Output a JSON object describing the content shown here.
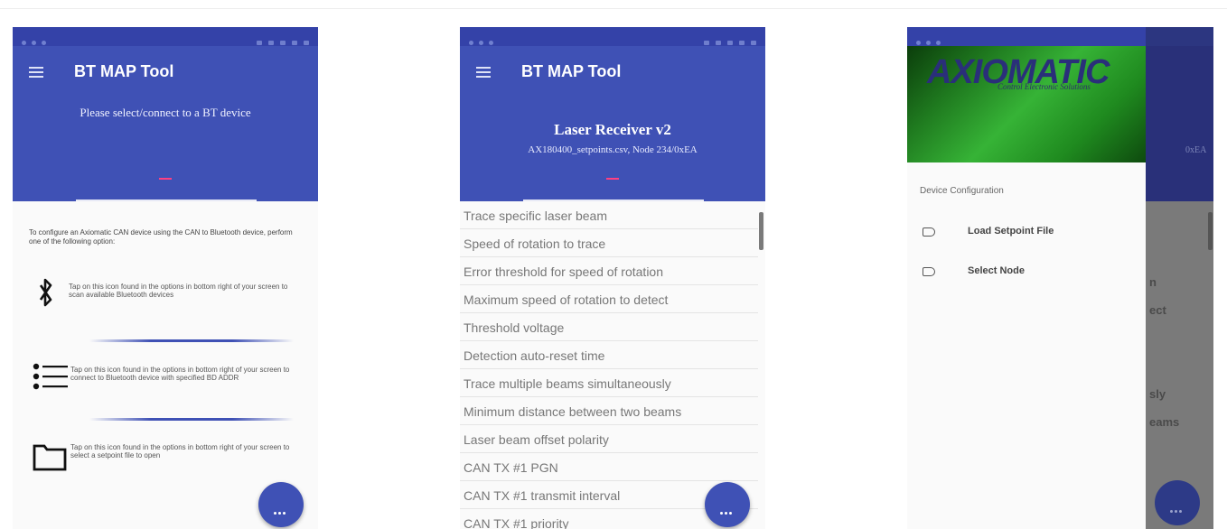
{
  "app": {
    "title": "BT MAP Tool"
  },
  "screen1": {
    "header_message": "Please select/connect to a BT device",
    "intro": "To configure an Axiomatic CAN device using the CAN to Bluetooth device, perform one of the following option:",
    "items": [
      {
        "icon": "bluetooth-icon",
        "text": "Tap on this icon found in the options in bottom right of your screen to scan available Bluetooth devices"
      },
      {
        "icon": "connect-list-icon",
        "text": "Tap on this icon found in the options in bottom right of your screen to connect to Bluetooth device with specified BD ADDR"
      },
      {
        "icon": "folder-icon",
        "text": "Tap on this icon found in the options in bottom right of your screen to select a setpoint file to open"
      }
    ],
    "fab_icon": "more-options-icon"
  },
  "screen2": {
    "device_name": "Laser Receiver v2",
    "device_file": "AX180400_setpoints.csv, Node 234/0xEA",
    "list": [
      "Trace specific laser beam",
      "Speed of rotation to trace",
      "Error threshold for speed of rotation",
      "Maximum speed of rotation to detect",
      "Threshold voltage",
      "Detection auto-reset time",
      "Trace multiple beams simultaneously",
      "Minimum distance between two beams",
      "Laser beam offset polarity",
      "CAN TX #1 PGN",
      "CAN TX #1 transmit interval",
      "CAN TX #1 priority"
    ]
  },
  "screen3": {
    "logo_text": "AXIOMATIC",
    "logo_tagline": "Control Electronic Solutions",
    "section_label": "Device Configuration",
    "menu": [
      {
        "icon": "label-icon",
        "label": "Load Setpoint File"
      },
      {
        "icon": "label-icon",
        "label": "Select Node"
      }
    ],
    "behind_fragments": [
      "0xEA",
      "n",
      "ect",
      "sly",
      "eams"
    ]
  },
  "colors": {
    "primary": "#3f51b5",
    "status_bar": "#3442a8",
    "accent": "#ff4081",
    "logo_green": "#36b336"
  }
}
